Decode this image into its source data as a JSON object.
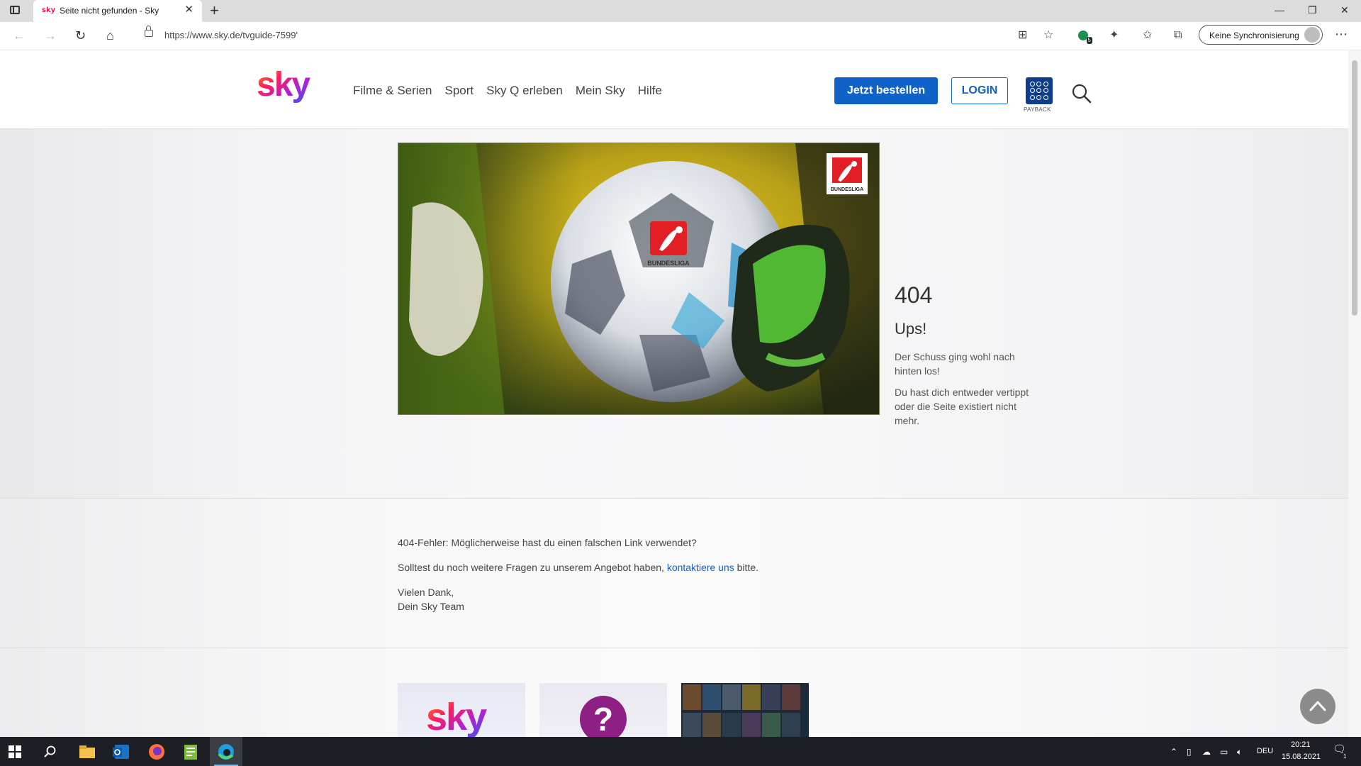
{
  "browser": {
    "tab_title": "Seite nicht gefunden - Sky",
    "tab_favicon": "sky",
    "url": "https://www.sky.de/tvguide-7599'",
    "sync_label": "Keine Synchronisierung",
    "extension_badge": "5"
  },
  "header": {
    "nav": [
      "Filme & Serien",
      "Sport",
      "Sky Q erleben",
      "Mein Sky",
      "Hilfe"
    ],
    "order_button": "Jetzt bestellen",
    "login_button": "LOGIN",
    "payback_label": "PAYBACK"
  },
  "error": {
    "code": "404",
    "title": "Ups!",
    "text1": "Der Schuss ging wohl nach hinten los!",
    "text2": "Du hast dich entweder vertippt oder die Seite existiert nicht mehr.",
    "image_badge": "BUNDESLIGA"
  },
  "info": {
    "line1": "404-Fehler: Möglicherweise hast du einen falschen Link verwendet?",
    "line2_before": "Solltest du noch weitere Fragen zu unserem Angebot haben, ",
    "line2_link": "kontaktiere uns",
    "line2_after": " bitte.",
    "thanks": "Vielen Dank,",
    "signature": "Dein Sky Team"
  },
  "taskbar": {
    "language": "DEU",
    "time": "20:21",
    "date": "15.08.2021",
    "notification_count": "1"
  },
  "colors": {
    "accent": "#0f63c8",
    "link": "#1a5fb4",
    "help_tile": "#8e1f85",
    "payback": "#0e3d8c"
  }
}
